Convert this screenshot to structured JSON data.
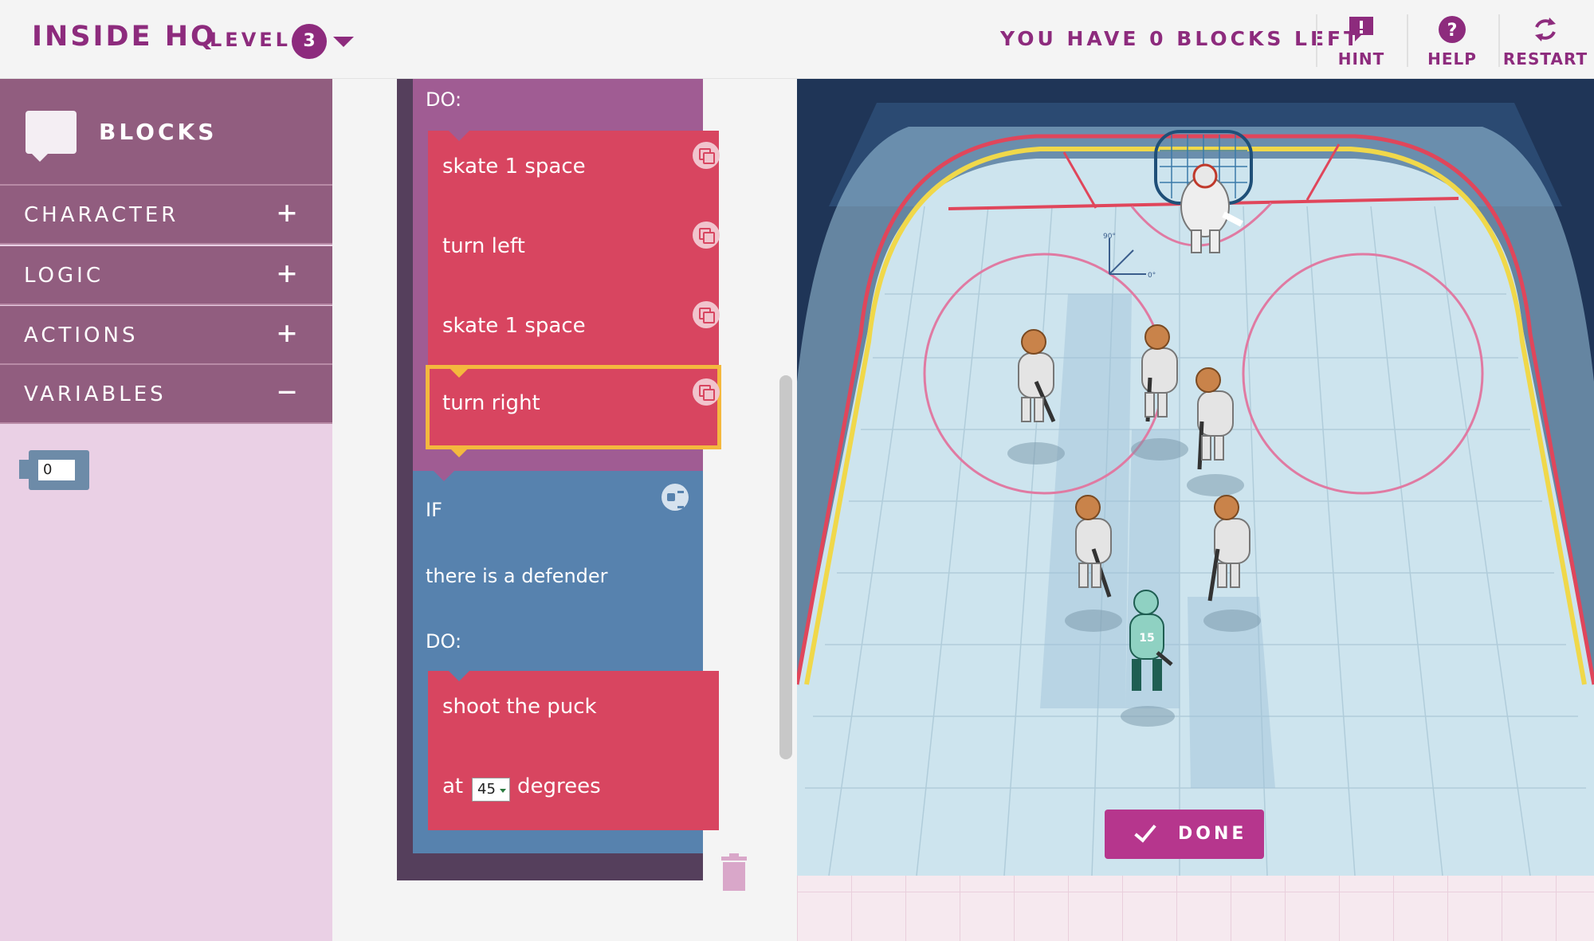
{
  "header": {
    "brand": "INSIDE HQ",
    "level_label": "LEVEL",
    "level_value": "3",
    "blocks_left": "YOU HAVE 0 BLOCKS LEFT",
    "buttons": {
      "hint": "HINT",
      "help": "HELP",
      "restart": "RESTART"
    }
  },
  "sidebar": {
    "title": "BLOCKS",
    "categories": [
      {
        "label": "CHARACTER",
        "sign": "+"
      },
      {
        "label": "LOGIC",
        "sign": "+"
      },
      {
        "label": "ACTIONS",
        "sign": "+"
      },
      {
        "label": "VARIABLES",
        "sign": "−"
      }
    ],
    "variable_value": "0"
  },
  "workspace": {
    "loop_do": "DO:",
    "actions": [
      {
        "label": "skate 1 space"
      },
      {
        "label": "turn left"
      },
      {
        "label": "skate 1 space"
      },
      {
        "label": "turn right"
      }
    ],
    "if_label": "IF",
    "if_condition": "there is a defender",
    "if_do": "DO:",
    "shoot_label": "shoot the puck",
    "shoot_at": "at",
    "shoot_angle": "45",
    "shoot_unit": "degrees"
  },
  "game": {
    "angle_90": "90°",
    "angle_0": "0°",
    "done_label": "DONE",
    "player_number": "15"
  },
  "colors": {
    "brand": "#8d2b7d",
    "action_block": "#d84560",
    "loop_block": "#a05c93",
    "if_block": "#5782ae",
    "selected_outline": "#f4b83e",
    "done_button": "#b6368d"
  }
}
